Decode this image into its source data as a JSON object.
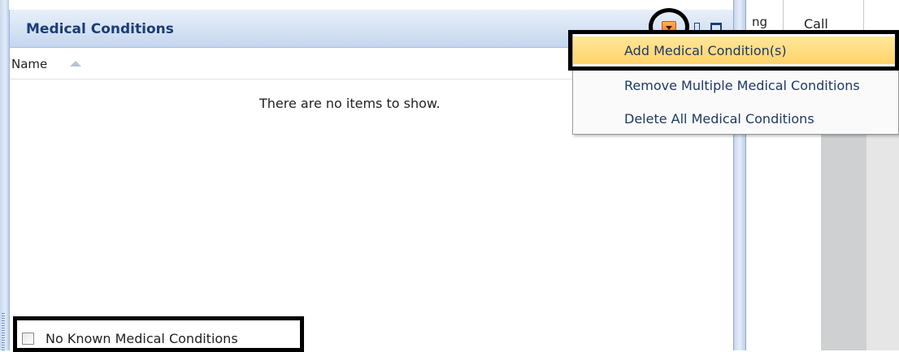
{
  "panel": {
    "title": "Medical Conditions",
    "column_header": "Name",
    "empty_message": "There are no items to show.",
    "no_known_label": "No Known Medical Conditions",
    "no_known_checked": false
  },
  "context_menu": {
    "items": [
      {
        "label": "Add Medical Condition(s)",
        "highlighted": true
      },
      {
        "label": "Remove Multiple Medical Conditions",
        "highlighted": false
      },
      {
        "label": "Delete All Medical Conditions",
        "highlighted": false
      }
    ]
  },
  "background_grid": {
    "partial_header": "ng",
    "call_header": "Call"
  },
  "icons": {
    "dropdown": "chevron-down-icon",
    "pin": "pin-icon",
    "maximize": "maximize-icon",
    "sort": "sort-ascending-icon"
  },
  "colors": {
    "title": "#1b3c78",
    "menu_highlight": "#ffd36a",
    "dropdown_button": "#f07b18"
  }
}
